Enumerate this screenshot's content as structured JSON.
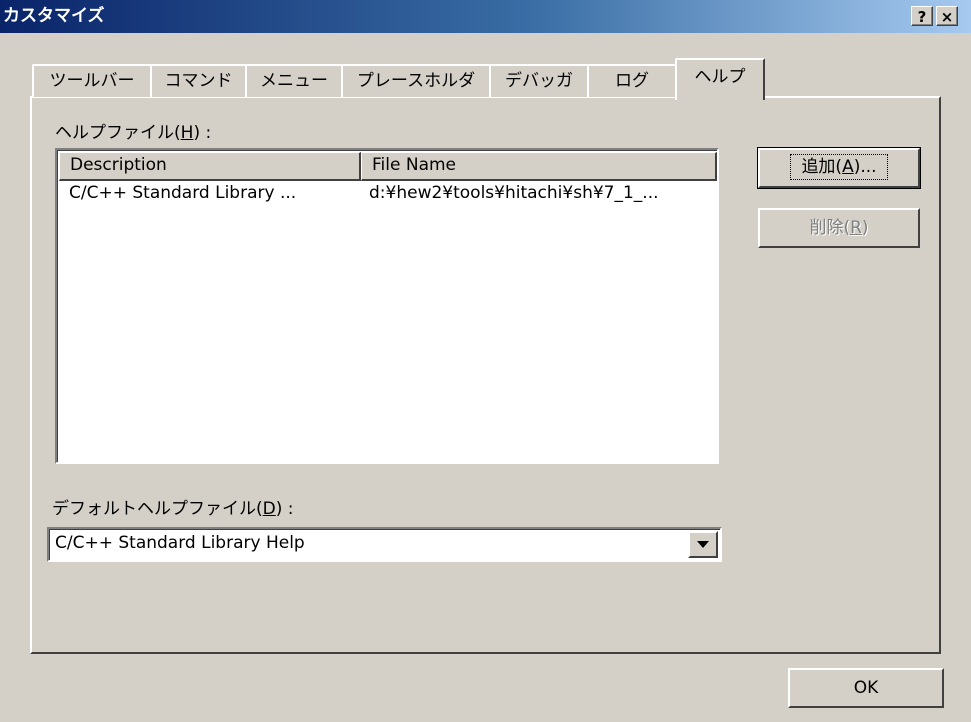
{
  "window": {
    "title": "カスタマイズ",
    "help_btn": "?",
    "close_btn": "×"
  },
  "tabs": [
    {
      "label": "ツールバー",
      "active": false
    },
    {
      "label": "コマンド",
      "active": false
    },
    {
      "label": "メニュー",
      "active": false
    },
    {
      "label": "プレースホルダ",
      "active": false
    },
    {
      "label": "デバッガ",
      "active": false
    },
    {
      "label": "ログ",
      "active": false
    },
    {
      "label": "ヘルプ",
      "active": true
    }
  ],
  "help_files": {
    "label_prefix": "ヘルプファイル(",
    "label_key": "H",
    "label_suffix": ") :",
    "columns": [
      "Description",
      "File Name"
    ],
    "rows": [
      {
        "description": "C/C++ Standard Library ...",
        "file_name": "d:¥hew2¥tools¥hitachi¥sh¥7_1_..."
      }
    ]
  },
  "buttons": {
    "add_prefix": "追加(",
    "add_key": "A",
    "add_suffix": ")...",
    "delete_prefix": "削除(",
    "delete_key": "R",
    "delete_suffix": ")",
    "ok": "OK"
  },
  "default_help": {
    "label_prefix": "デフォルトヘルプファイル(",
    "label_key": "D",
    "label_suffix": ") :",
    "selected": "C/C++ Standard Library Help"
  },
  "colors": {
    "titlebar_start": "#0a246a",
    "titlebar_end": "#a6caf0",
    "face": "#d4d0c8"
  }
}
